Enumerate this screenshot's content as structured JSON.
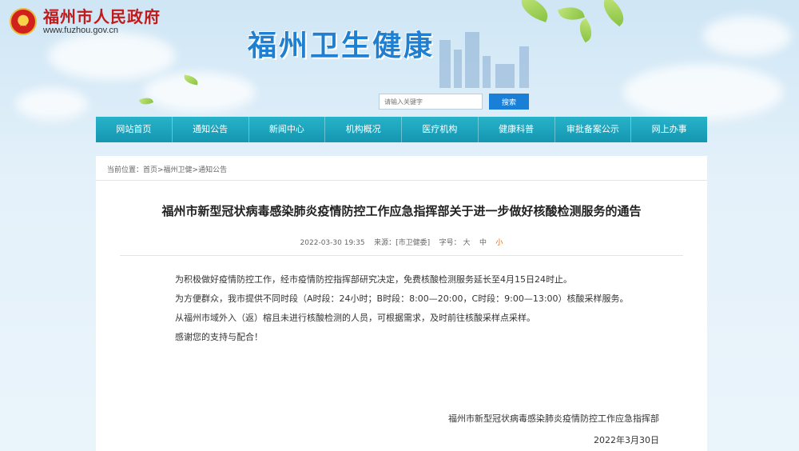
{
  "header": {
    "gov_name": "福州市人民政府",
    "gov_url": "www.fuzhou.gov.cn",
    "site_title": "福州卫生健康"
  },
  "search": {
    "placeholder": "请输入关键字",
    "button_label": "搜索"
  },
  "nav": {
    "items": [
      {
        "label": "网站首页"
      },
      {
        "label": "通知公告"
      },
      {
        "label": "新闻中心"
      },
      {
        "label": "机构概况"
      },
      {
        "label": "医疗机构"
      },
      {
        "label": "健康科普"
      },
      {
        "label": "审批备案公示"
      },
      {
        "label": "网上办事"
      }
    ]
  },
  "breadcrumb": {
    "prefix": "当前位置：",
    "path": "首页>福州卫健>通知公告"
  },
  "article": {
    "title": "福州市新型冠状病毒感染肺炎疫情防控工作应急指挥部关于进一步做好核酸检测服务的通告",
    "date": "2022-03-30 19:35",
    "source": "来源：[市卫健委]",
    "font_label": "字号：",
    "font_large": "大",
    "font_medium": "中",
    "font_small": "小",
    "paragraphs": [
      "为积极做好疫情防控工作，经市疫情防控指挥部研究决定，免费核酸检测服务延长至4月15日24时止。",
      "为方便群众，我市提供不同时段（A时段：24小时；B时段：8:00—20:00，C时段：9:00—13:00）核酸采样服务。",
      "从福州市域外入（返）榕且未进行核酸检测的人员，可根据需求，及时前往核酸采样点采样。",
      "感谢您的支持与配合！"
    ],
    "signature": "福州市新型冠状病毒感染肺炎疫情防控工作应急指挥部",
    "sign_date": "2022年3月30日"
  },
  "colors": {
    "nav_bg": "#1a9fb8",
    "search_button": "#1a7fd6",
    "site_title": "#1f7fd0",
    "gov_title": "#c21a1a",
    "font_small_active": "#e06a1a"
  }
}
